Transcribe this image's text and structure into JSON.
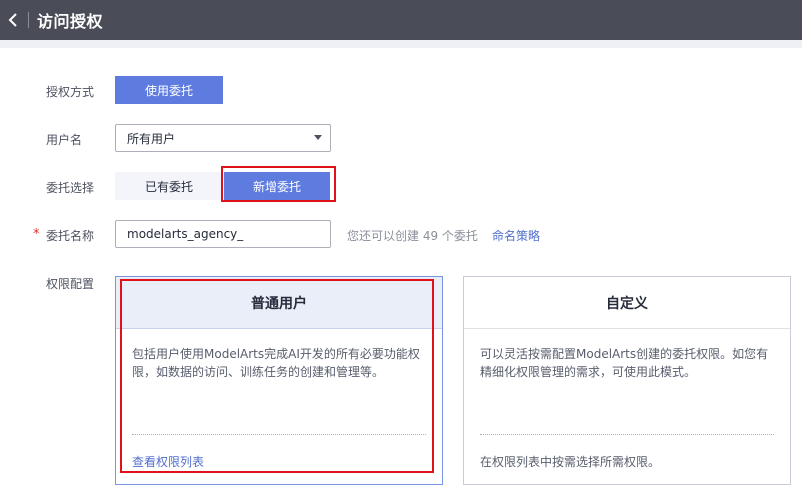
{
  "header": {
    "title": "访问授权"
  },
  "form": {
    "auth_method": {
      "label": "授权方式",
      "button": "使用委托"
    },
    "user": {
      "label": "用户名",
      "value": "所有用户"
    },
    "agency_choice": {
      "label": "委托选择",
      "existing": "已有委托",
      "new": "新增委托"
    },
    "agency_name": {
      "required_mark": "*",
      "label": "委托名称",
      "value": "modelarts_agency_",
      "hint": "您还可以创建 49 个委托",
      "link": "命名策略"
    },
    "permission": {
      "label": "权限配置",
      "cards": [
        {
          "title": "普通用户",
          "desc": "包括用户使用ModelArts完成AI开发的所有必要功能权限，如数据的访问、训练任务的创建和管理等。",
          "footer": "查看权限列表"
        },
        {
          "title": "自定义",
          "desc": "可以灵活按需配置ModelArts创建的委托权限。如您有精细化权限管理的需求，可使用此模式。",
          "footer": "在权限列表中按需选择所需权限。"
        }
      ]
    }
  }
}
